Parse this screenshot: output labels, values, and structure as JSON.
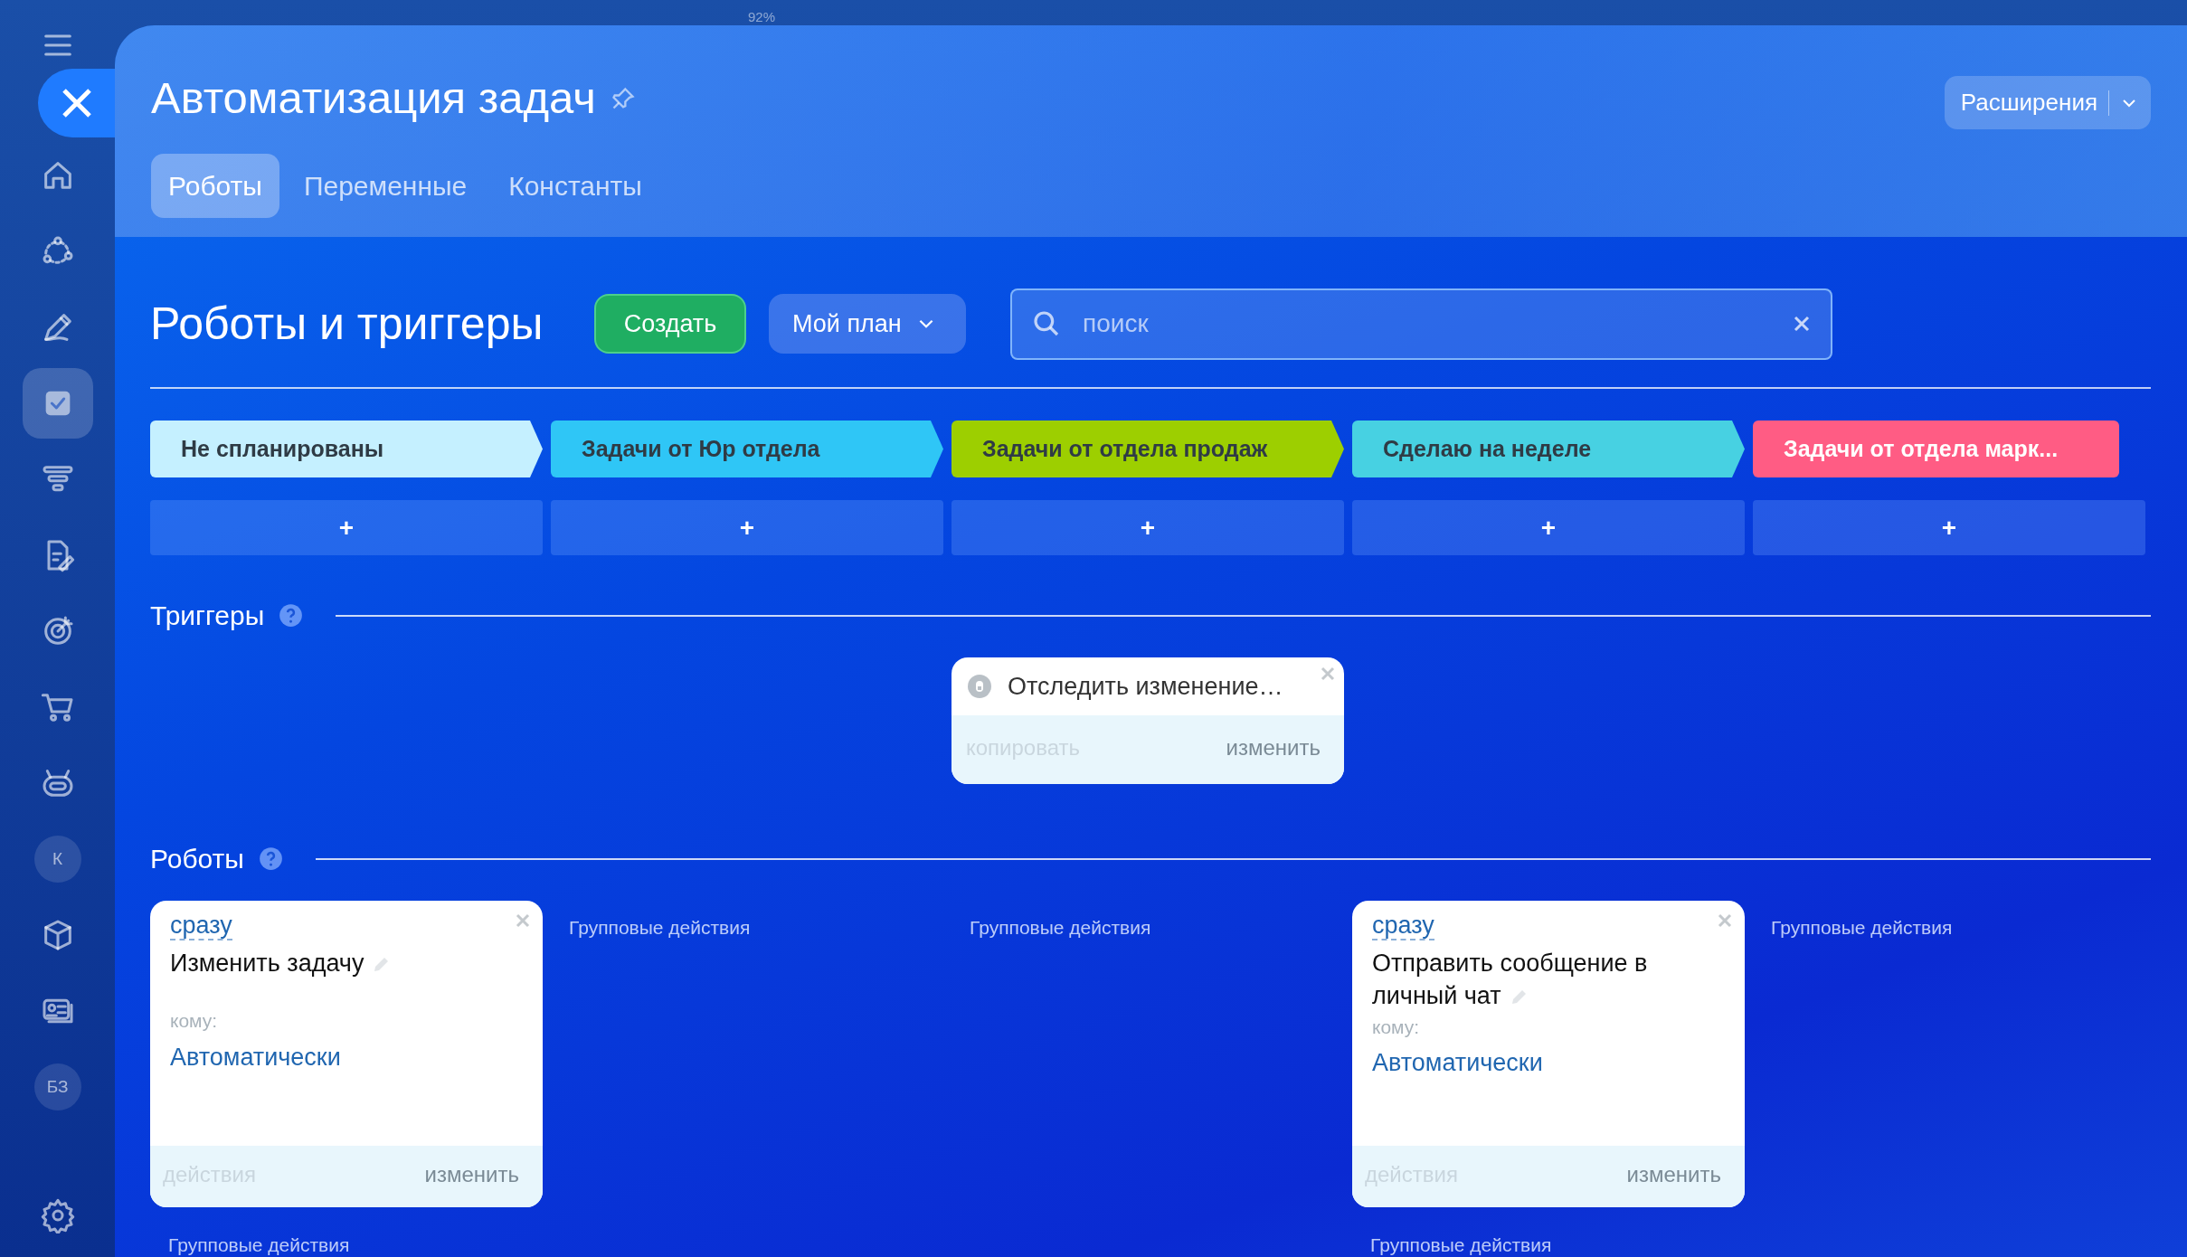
{
  "top_strip": {
    "zoom": "92%"
  },
  "sidebar": {
    "items": [
      {
        "kind": "menu",
        "selected": false
      },
      {
        "kind": "close",
        "selected": false
      },
      {
        "kind": "icon",
        "selected": false
      },
      {
        "kind": "icon",
        "selected": false
      },
      {
        "kind": "icon",
        "selected": false
      },
      {
        "kind": "icon",
        "selected": true
      },
      {
        "kind": "icon",
        "selected": false
      },
      {
        "kind": "icon",
        "selected": false
      },
      {
        "kind": "icon",
        "selected": false
      },
      {
        "kind": "icon",
        "selected": false
      },
      {
        "kind": "icon",
        "selected": false
      },
      {
        "kind": "avatar",
        "label": "К",
        "selected": false
      },
      {
        "kind": "icon",
        "selected": false
      },
      {
        "kind": "icon",
        "selected": false
      },
      {
        "kind": "avatar",
        "label": "БЗ",
        "selected": false
      },
      {
        "kind": "settings",
        "selected": false
      }
    ]
  },
  "header": {
    "title": "Автоматизация задач",
    "extensions_button": "Расширения",
    "tabs": [
      {
        "label": "Роботы",
        "selected": true
      },
      {
        "label": "Переменные",
        "selected": false
      },
      {
        "label": "Константы",
        "selected": false
      }
    ]
  },
  "toolbar": {
    "heading": "Роботы и триггеры",
    "create_button": "Создать",
    "plan_button": "Мой план",
    "search": {
      "placeholder": "поиск"
    }
  },
  "triggers_heading": "Триггеры",
  "robots_heading": "Роботы",
  "stages": [
    {
      "label": "Не спланированы",
      "color": "#c5f0ff",
      "add": "+",
      "robots": [
        {
          "delay": "сразу",
          "title": "Изменить задачу",
          "recipient_label": "кому:",
          "recipient": "Автоматически",
          "footer_left": "действия",
          "footer_left_disabled": true,
          "footer_right": "изменить"
        }
      ],
      "group_label": "Групповые действия"
    },
    {
      "label": "Задачи от Юр отдела",
      "color": "#2fc6f6",
      "add": "+",
      "group_label": "Групповые действия"
    },
    {
      "label": "Задачи от отдела продаж",
      "color": "#9dcf00",
      "add": "+",
      "triggers": [
        {
          "title": "Отследить изменение…",
          "footer_left": "копировать",
          "footer_left_disabled": true,
          "footer_right": "изменить"
        }
      ],
      "group_label": "Групповые действия"
    },
    {
      "label": "Сделаю на неделе",
      "color": "#47d1e2",
      "add": "+",
      "robots": [
        {
          "delay": "сразу",
          "title": "Отправить сообщение в личный чат",
          "recipient_label": "кому:",
          "recipient": "Автоматически",
          "footer_left": "действия",
          "footer_left_disabled": true,
          "footer_right": "изменить"
        }
      ],
      "group_label": "Групповые действия"
    },
    {
      "label": "Задачи от отдела марк...",
      "color": "#ff5c84",
      "add": "+",
      "group_label": "Групповые действия"
    }
  ]
}
